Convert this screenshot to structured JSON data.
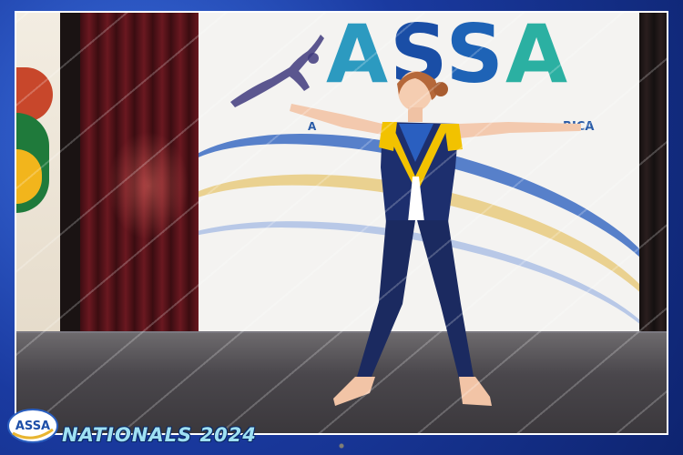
{
  "banner": {
    "logo_text": "ASSA",
    "subtitle_left": "A",
    "subtitle_right": "RICA"
  },
  "footer": {
    "logo_text": "ASSA",
    "title": "NATIONALS 2024"
  },
  "colors": {
    "frame_blue": "#1a3aa0",
    "costume_navy": "#1d2f6e",
    "costume_yellow": "#f2c200",
    "footer_text": "#9fe0f2"
  }
}
